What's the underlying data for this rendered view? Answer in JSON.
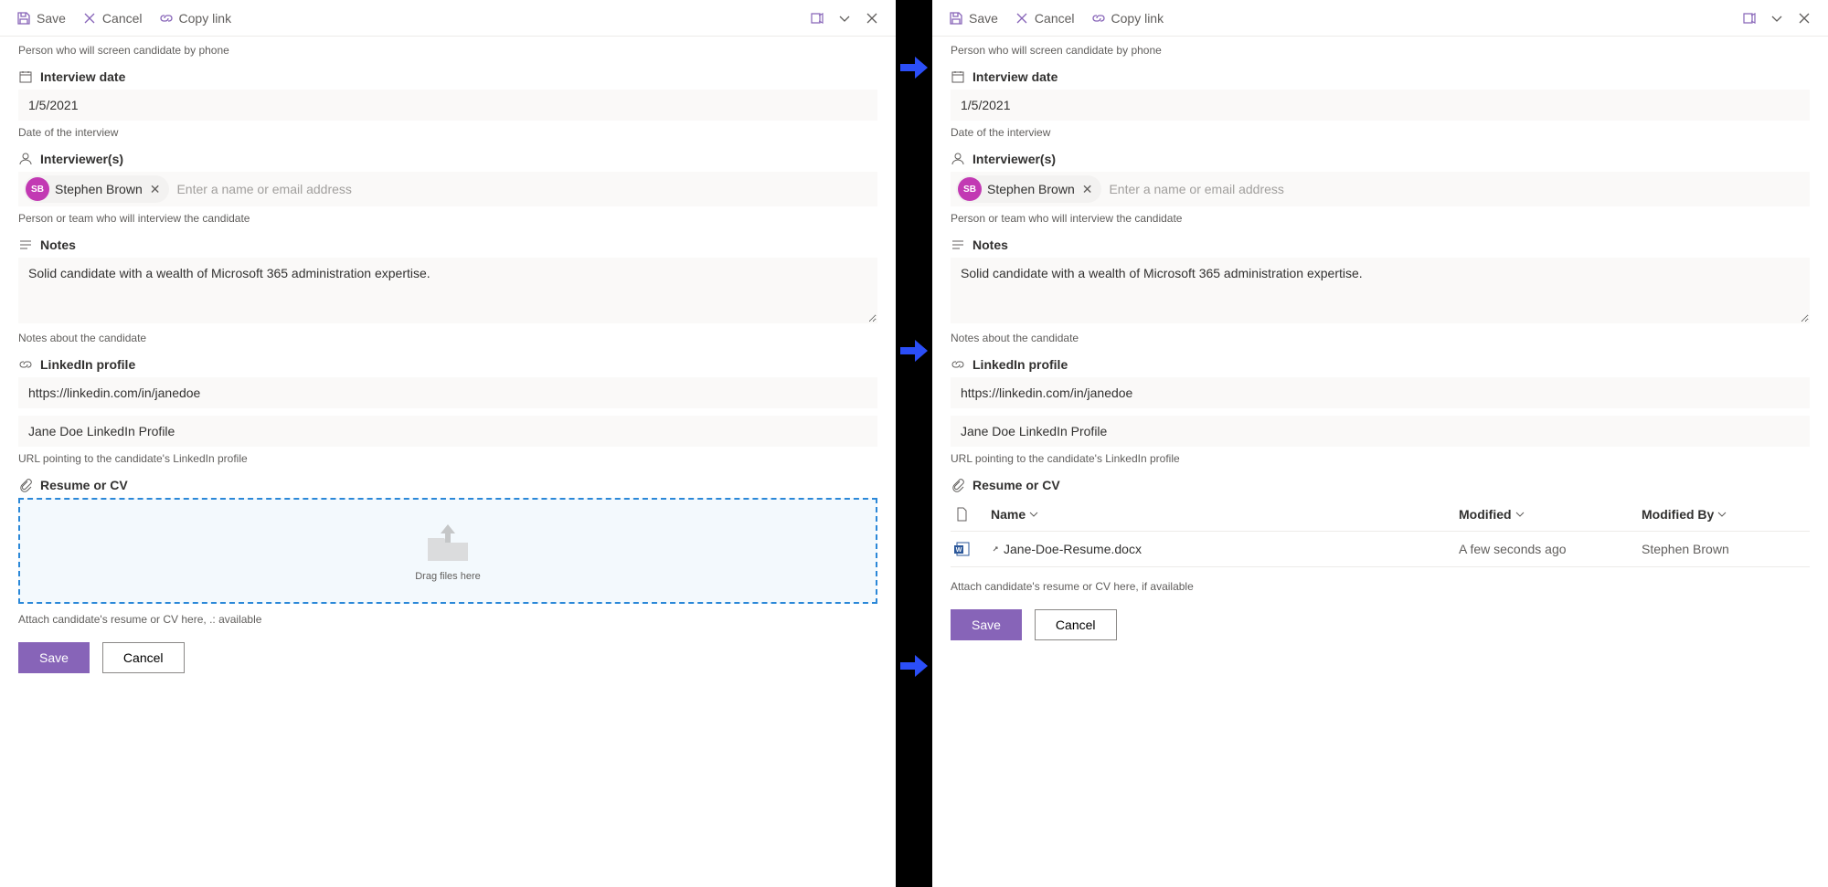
{
  "toolbar": {
    "save": "Save",
    "cancel": "Cancel",
    "copylink": "Copy link"
  },
  "screener_help": "Person who will screen candidate by phone",
  "interview_date": {
    "label": "Interview date",
    "value": "1/5/2021",
    "help": "Date of the interview"
  },
  "interviewers": {
    "label": "Interviewer(s)",
    "chip_name": "Stephen Brown",
    "avatar_initials": "SB",
    "placeholder": "Enter a name or email address",
    "help": "Person or team who will interview the candidate"
  },
  "notes": {
    "label": "Notes",
    "value": "Solid candidate with a wealth of Microsoft 365 administration expertise.",
    "help": "Notes about the candidate"
  },
  "linkedin": {
    "label": "LinkedIn profile",
    "value": "https://linkedin.com/in/janedoe",
    "display": "Jane Doe LinkedIn Profile",
    "help": "URL pointing to the candidate's LinkedIn profile"
  },
  "resume": {
    "label": "Resume or CV",
    "drop_text": "Drag files here",
    "help_left": "Attach candidate's resume or CV here, .: available",
    "help_right": "Attach candidate's resume or CV here, if available"
  },
  "file_table": {
    "col_name": "Name",
    "col_modified": "Modified",
    "col_modifiedby": "Modified By",
    "row": {
      "name": "Jane-Doe-Resume.docx",
      "modified": "A few seconds ago",
      "modifiedby": "Stephen Brown"
    }
  },
  "buttons": {
    "save": "Save",
    "cancel": "Cancel"
  }
}
